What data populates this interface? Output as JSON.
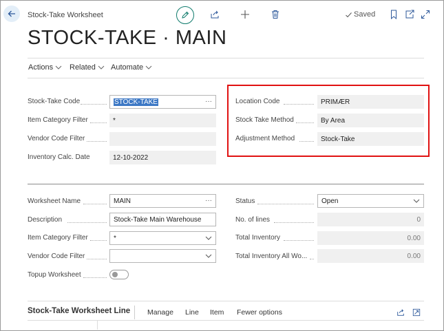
{
  "header": {
    "caption": "Stock-Take Worksheet",
    "saved_label": "Saved",
    "title": "STOCK-TAKE · MAIN"
  },
  "actions": [
    {
      "label": "Actions"
    },
    {
      "label": "Related"
    },
    {
      "label": "Automate"
    }
  ],
  "general": {
    "stock_take_code": {
      "label": "Stock-Take Code",
      "value": "STOCK-TAKE"
    },
    "item_category_filter": {
      "label": "Item Category Filter",
      "value": "*"
    },
    "vendor_code_filter": {
      "label": "Vendor Code Filter",
      "value": ""
    },
    "inventory_calc_date": {
      "label": "Inventory Calc. Date",
      "value": "12-10-2022"
    },
    "location_code": {
      "label": "Location Code",
      "value": "PRIMÆR"
    },
    "stock_take_method": {
      "label": "Stock Take Method",
      "value": "By Area"
    },
    "adjustment_method": {
      "label": "Adjustment Method",
      "value": "Stock-Take"
    }
  },
  "worksheet": {
    "worksheet_name": {
      "label": "Worksheet Name",
      "value": "MAIN"
    },
    "description": {
      "label": "Description",
      "value": "Stock-Take Main Warehouse"
    },
    "item_category_filter": {
      "label": "Item Category Filter",
      "value": "*"
    },
    "vendor_code_filter": {
      "label": "Vendor Code Filter",
      "value": ""
    },
    "topup_worksheet": {
      "label": "Topup Worksheet",
      "value": false
    },
    "status": {
      "label": "Status",
      "value": "Open"
    },
    "no_of_lines": {
      "label": "No. of lines",
      "value": "0"
    },
    "total_inventory": {
      "label": "Total Inventory",
      "value": "0.00"
    },
    "total_inventory_all": {
      "label": "Total Inventory All Wo...",
      "value": "0.00"
    }
  },
  "lines_section": {
    "title": "Stock-Take Worksheet Line",
    "actions": [
      "Manage",
      "Line",
      "Item",
      "Fewer options"
    ]
  },
  "colors": {
    "accent": "#0f7b6c",
    "highlight_box": "#e01111",
    "selection": "#3d78c5"
  },
  "icons": [
    "back-arrow-icon",
    "pencil-icon",
    "share-icon",
    "plus-icon",
    "trash-icon",
    "check-icon",
    "bookmark-icon",
    "open-new-window-icon",
    "expand-icon",
    "chevron-down-icon",
    "ellipsis-icon",
    "share-small-icon",
    "expand-small-icon"
  ]
}
